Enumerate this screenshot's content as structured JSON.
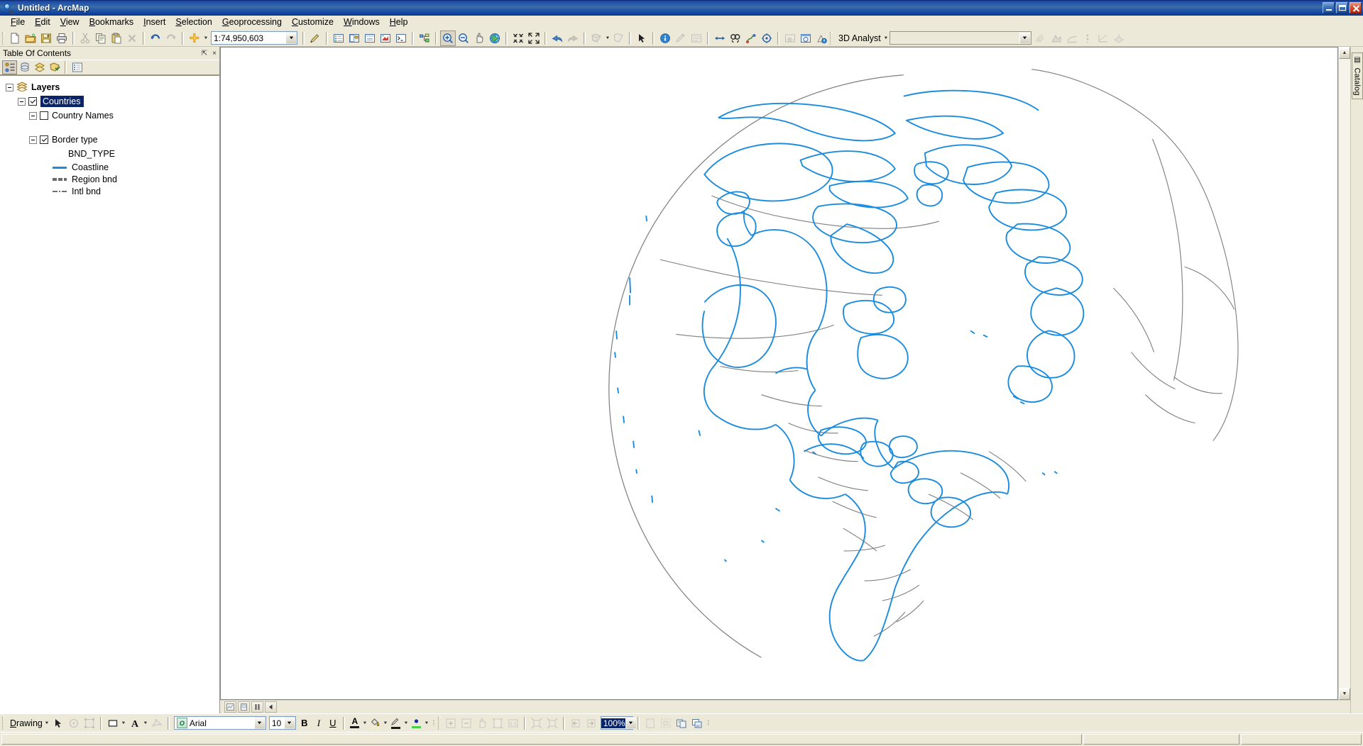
{
  "window": {
    "title": "Untitled - ArcMap",
    "icon": "magnifier-globe-icon",
    "minimize_label": "Minimize",
    "maximize_label": "Maximize",
    "close_label": "Close"
  },
  "menubar": {
    "items": [
      {
        "label": "File",
        "mnemonic": "F"
      },
      {
        "label": "Edit",
        "mnemonic": "E"
      },
      {
        "label": "View",
        "mnemonic": "V"
      },
      {
        "label": "Bookmarks",
        "mnemonic": "B"
      },
      {
        "label": "Insert",
        "mnemonic": "I"
      },
      {
        "label": "Selection",
        "mnemonic": "S"
      },
      {
        "label": "Geoprocessing",
        "mnemonic": "G"
      },
      {
        "label": "Customize",
        "mnemonic": "C"
      },
      {
        "label": "Windows",
        "mnemonic": "W"
      },
      {
        "label": "Help",
        "mnemonic": "H"
      }
    ]
  },
  "toolbar": {
    "scale": {
      "value": "1:74,950,603",
      "name": "map-scale-combo"
    },
    "extension": {
      "label": "3D Analyst",
      "layer_value": ""
    },
    "buttons": [
      {
        "name": "new-map",
        "tip": "New Map File"
      },
      {
        "name": "open-file",
        "tip": "Open"
      },
      {
        "name": "save-file",
        "tip": "Save"
      },
      {
        "name": "print",
        "tip": "Print"
      },
      {
        "name": "cut",
        "tip": "Cut"
      },
      {
        "name": "copy",
        "tip": "Copy"
      },
      {
        "name": "paste",
        "tip": "Paste"
      },
      {
        "name": "delete",
        "tip": "Delete"
      },
      {
        "name": "undo",
        "tip": "Undo"
      },
      {
        "name": "redo",
        "tip": "Redo"
      },
      {
        "name": "add-data",
        "tip": "Add Data"
      },
      {
        "name": "editor-toolbar",
        "tip": "Editor Toolbar"
      },
      {
        "name": "table-of-contents",
        "tip": "Table Of Contents"
      },
      {
        "name": "catalog-window",
        "tip": "Catalog"
      },
      {
        "name": "search-window",
        "tip": "Search"
      },
      {
        "name": "arctoolbox-window",
        "tip": "ArcToolbox"
      },
      {
        "name": "python-window",
        "tip": "Python Window"
      },
      {
        "name": "model-builder",
        "tip": "ModelBuilder"
      },
      {
        "name": "zoom-in",
        "tip": "Zoom In"
      },
      {
        "name": "zoom-out",
        "tip": "Zoom Out"
      },
      {
        "name": "pan",
        "tip": "Pan"
      },
      {
        "name": "full-extent",
        "tip": "Full Extent"
      },
      {
        "name": "fixed-zoom-in",
        "tip": "Fixed Zoom In"
      },
      {
        "name": "fixed-zoom-out",
        "tip": "Fixed Zoom Out"
      },
      {
        "name": "go-back-extent",
        "tip": "Go Back To Previous Extent"
      },
      {
        "name": "go-next-extent",
        "tip": "Go To Next Extent"
      },
      {
        "name": "select-features",
        "tip": "Select Features"
      },
      {
        "name": "clear-selection",
        "tip": "Clear Selected Features"
      },
      {
        "name": "select-elements",
        "tip": "Select Elements"
      },
      {
        "name": "identify",
        "tip": "Identify"
      },
      {
        "name": "hyperlink",
        "tip": "Hyperlink"
      },
      {
        "name": "html-popup",
        "tip": "HTML Popup"
      },
      {
        "name": "measure",
        "tip": "Measure"
      },
      {
        "name": "find",
        "tip": "Find"
      },
      {
        "name": "find-route",
        "tip": "Find Route"
      },
      {
        "name": "go-to-xy",
        "tip": "Go To XY"
      },
      {
        "name": "time-slider",
        "tip": "Time Slider"
      },
      {
        "name": "create-viewer-window",
        "tip": "Create Viewer Window"
      },
      {
        "name": "whats-this-help",
        "tip": "What's This?"
      }
    ]
  },
  "toc": {
    "title": "Table Of Contents",
    "autohide_label": "Auto Hide",
    "close_label": "Close",
    "tabs": [
      {
        "name": "list-by-drawing-order",
        "active": true
      },
      {
        "name": "list-by-source",
        "active": false
      },
      {
        "name": "list-by-visibility",
        "active": false
      },
      {
        "name": "list-by-selection",
        "active": false
      },
      {
        "name": "options",
        "active": false
      }
    ],
    "tree": {
      "root": {
        "label": "Layers",
        "expanded": true,
        "icon": "layers-icon"
      },
      "layer": {
        "label": "Countries",
        "checked": true,
        "selected": true,
        "expanded": true
      },
      "sublayers": [
        {
          "label": "Country Names",
          "checked": false,
          "expanded": true
        },
        {
          "label": "Border type",
          "checked": true,
          "expanded": true
        }
      ],
      "field_heading": "BND_TYPE",
      "legend": [
        {
          "label": "Coastline",
          "color": "#1b8bde",
          "style": "solid",
          "width": 3
        },
        {
          "label": "Region bnd",
          "color": "#696969",
          "style": "dashed",
          "width": 4
        },
        {
          "label": "Intl bnd",
          "color": "#6e6e6e",
          "style": "dash-dot",
          "width": 2
        }
      ]
    }
  },
  "map": {
    "projection": "orthographic-western-hemisphere",
    "coastline_color": "#1b8bde",
    "border_color": "#7d7d7d",
    "background": "#ffffff",
    "status_buttons": [
      {
        "name": "map-view-button"
      },
      {
        "name": "refresh-view-button"
      },
      {
        "name": "pause-drawing-button"
      },
      {
        "name": "continuous-refresh-button"
      }
    ]
  },
  "right_dock": {
    "tab_label": "Catalog",
    "tab_icon": "catalog-icon"
  },
  "drawbar": {
    "menu_label": "Drawing",
    "font": {
      "name_value": "Arial",
      "size_value": "10"
    },
    "bold_label": "B",
    "italic_label": "I",
    "underline_label": "U",
    "zoom_value": "100%",
    "buttons": [
      {
        "name": "select-elements-tool"
      },
      {
        "name": "rotate-element-tool"
      },
      {
        "name": "edit-vertices-tool"
      },
      {
        "name": "fill-color-picker"
      },
      {
        "name": "font-color-picker"
      },
      {
        "name": "draw-shape-tool"
      },
      {
        "name": "text-color-picker"
      },
      {
        "name": "highlight-color-picker"
      },
      {
        "name": "line-color-picker"
      },
      {
        "name": "marker-color-picker"
      },
      {
        "name": "zoom-in-layout"
      },
      {
        "name": "zoom-out-layout"
      },
      {
        "name": "pan-layout"
      },
      {
        "name": "zoom-whole-page"
      },
      {
        "name": "zoom-100-percent"
      },
      {
        "name": "fixed-zoom-in-layout"
      },
      {
        "name": "fixed-zoom-out-layout"
      },
      {
        "name": "go-back-extent-layout"
      },
      {
        "name": "go-forward-extent-layout"
      },
      {
        "name": "toggle-draft-mode"
      },
      {
        "name": "focus-data-frame"
      },
      {
        "name": "change-layout"
      },
      {
        "name": "data-driven-pages"
      }
    ]
  },
  "statusbar": {
    "message": "",
    "coordinates": "",
    "units": ""
  }
}
